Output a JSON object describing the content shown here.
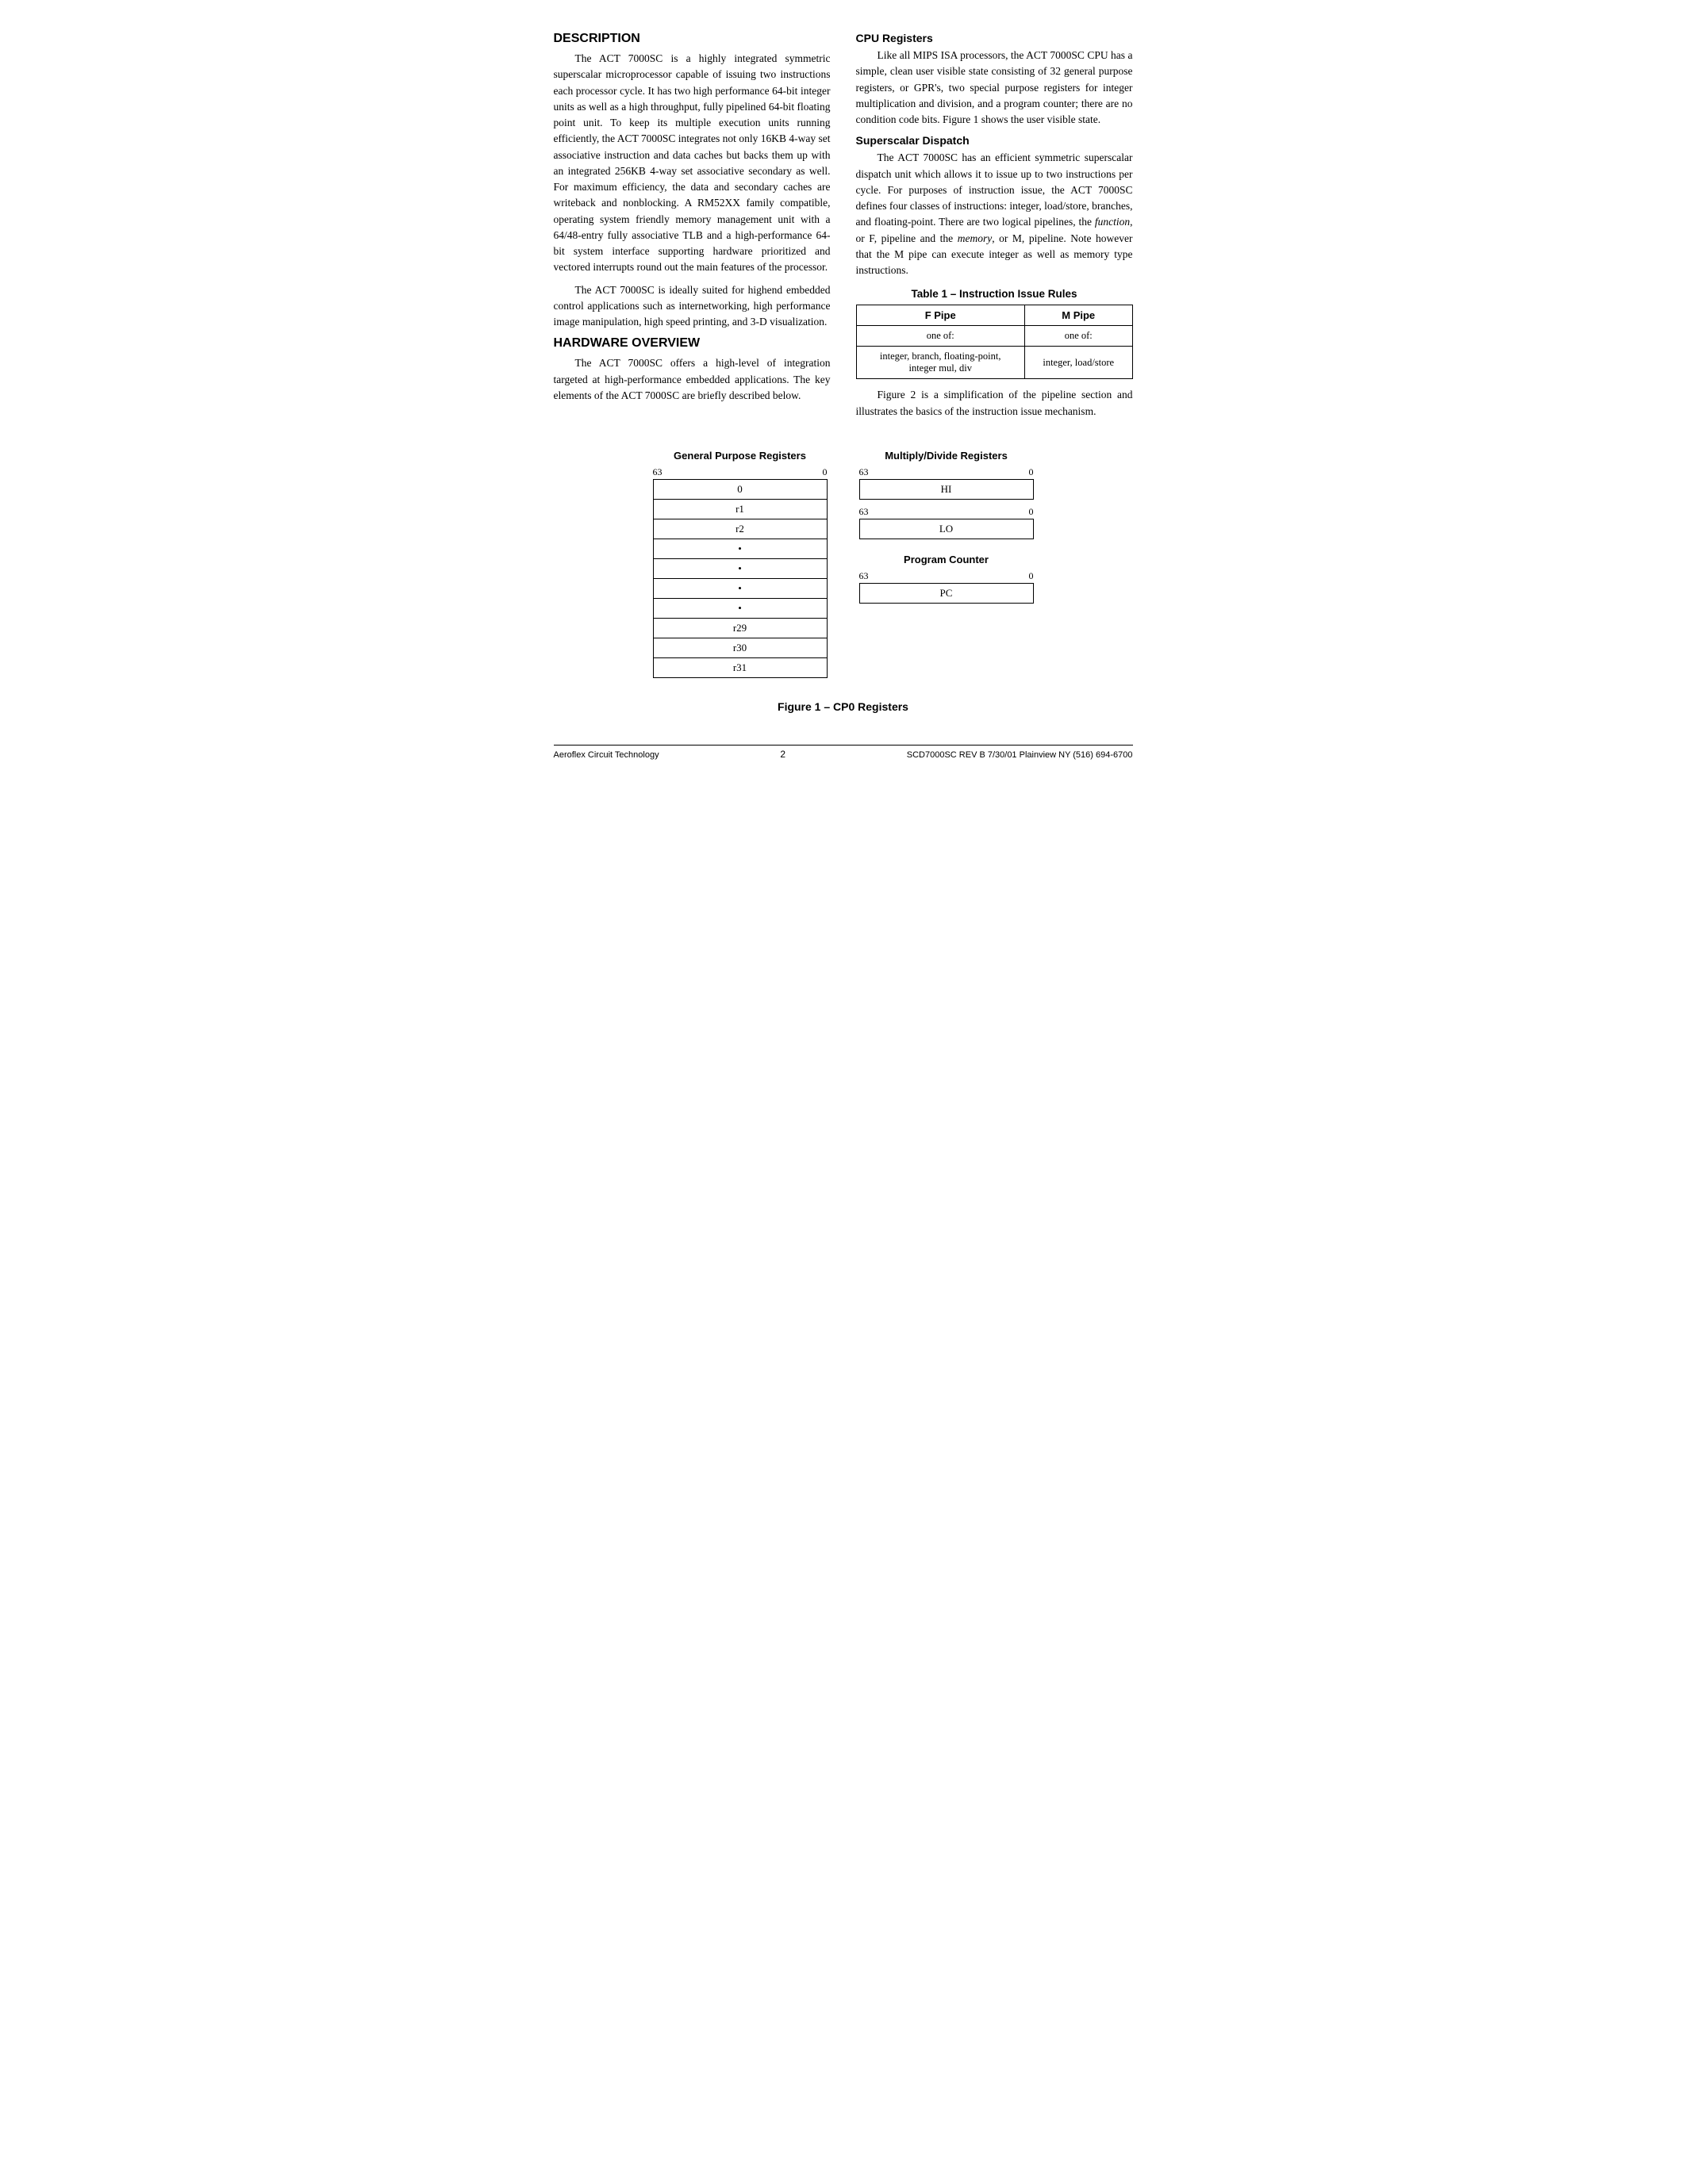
{
  "page": {
    "description_title": "DESCRIPTION",
    "hardware_title": "HARDWARE OVERVIEW",
    "description_p1": "The ACT 7000SC is a highly integrated symmetric superscalar microprocessor capable of issuing two instructions each processor cycle. It has two high performance 64-bit integer units as well as a high throughput, fully pipelined 64-bit floating point unit. To keep its multiple execution units running efficiently, the ACT 7000SC integrates not only 16KB 4-way set associative instruction and data caches but backs them up with an integrated 256KB 4-way set associative secondary as well. For maximum efficiency, the data and secondary caches are writeback and nonblocking. A RM52XX family compatible, operating system friendly memory management unit with a 64/48-entry fully associative TLB and a high-performance 64-bit system interface supporting hardware prioritized and vectored interrupts round out the main features of the processor.",
    "description_p2": "The ACT 7000SC is ideally suited for highend embedded control applications such as internetworking, high performance image manipulation, high speed printing, and 3-D visualization.",
    "hardware_p1": "The ACT 7000SC offers a high-level of integration targeted at high-performance embedded applications. The key elements of the ACT 7000SC are briefly described below.",
    "cpu_registers_title": "CPU Registers",
    "cpu_registers_p1": "Like all MIPS ISA processors, the ACT 7000SC CPU has a simple, clean user visible state consisting of 32 general purpose registers, or GPR's, two special purpose registers for integer multiplication and division, and a program counter; there are no condition code bits. Figure 1 shows the user visible state.",
    "superscalar_title": "Superscalar Dispatch",
    "superscalar_p1": "The ACT 7000SC has an efficient symmetric superscalar dispatch unit which allows it to issue up to two instructions per cycle. For purposes of instruction issue, the ACT 7000SC defines four classes of instructions: integer, load/store, branches, and floating-point. There are two logical pipelines, the function, or F, pipeline and the memory, or M, pipeline. Note however that the M pipe can execute integer as well as memory type instructions.",
    "table_title": "Table 1 – Instruction Issue Rules",
    "table_headers": [
      "F Pipe",
      "M Pipe"
    ],
    "table_row1": [
      "one of:",
      "one of:"
    ],
    "table_row2": [
      "integer, branch, floating-point,\ninteger mul, div",
      "integer, load/store"
    ],
    "figure_below_table": "Figure 2 is a simplification of the pipeline section and illustrates the basics of the instruction issue mechanism.",
    "gpr_title": "General Purpose Registers",
    "gpr_bit_left": "63",
    "gpr_bit_right": "0",
    "gpr_rows": [
      "0",
      "r1",
      "r2",
      "•",
      "•",
      "•",
      "•",
      "r29",
      "r30",
      "r31"
    ],
    "mdr_title": "Multiply/Divide Registers",
    "mdr_bit_left": "63",
    "mdr_bit_right": "0",
    "mdr_hi": "HI",
    "mdr_lo_bit_left": "63",
    "mdr_lo_bit_right": "0",
    "mdr_lo": "LO",
    "pc_title": "Program Counter",
    "pc_bit_left": "63",
    "pc_bit_right": "0",
    "pc_label": "PC",
    "figure_caption": "Figure 1 – CP0 Registers",
    "footer_left": "Aeroflex Circuit Technology",
    "footer_center": "2",
    "footer_right": "SCD7000SC REV B  7/30/01  Plainview NY (516) 694-6700"
  }
}
